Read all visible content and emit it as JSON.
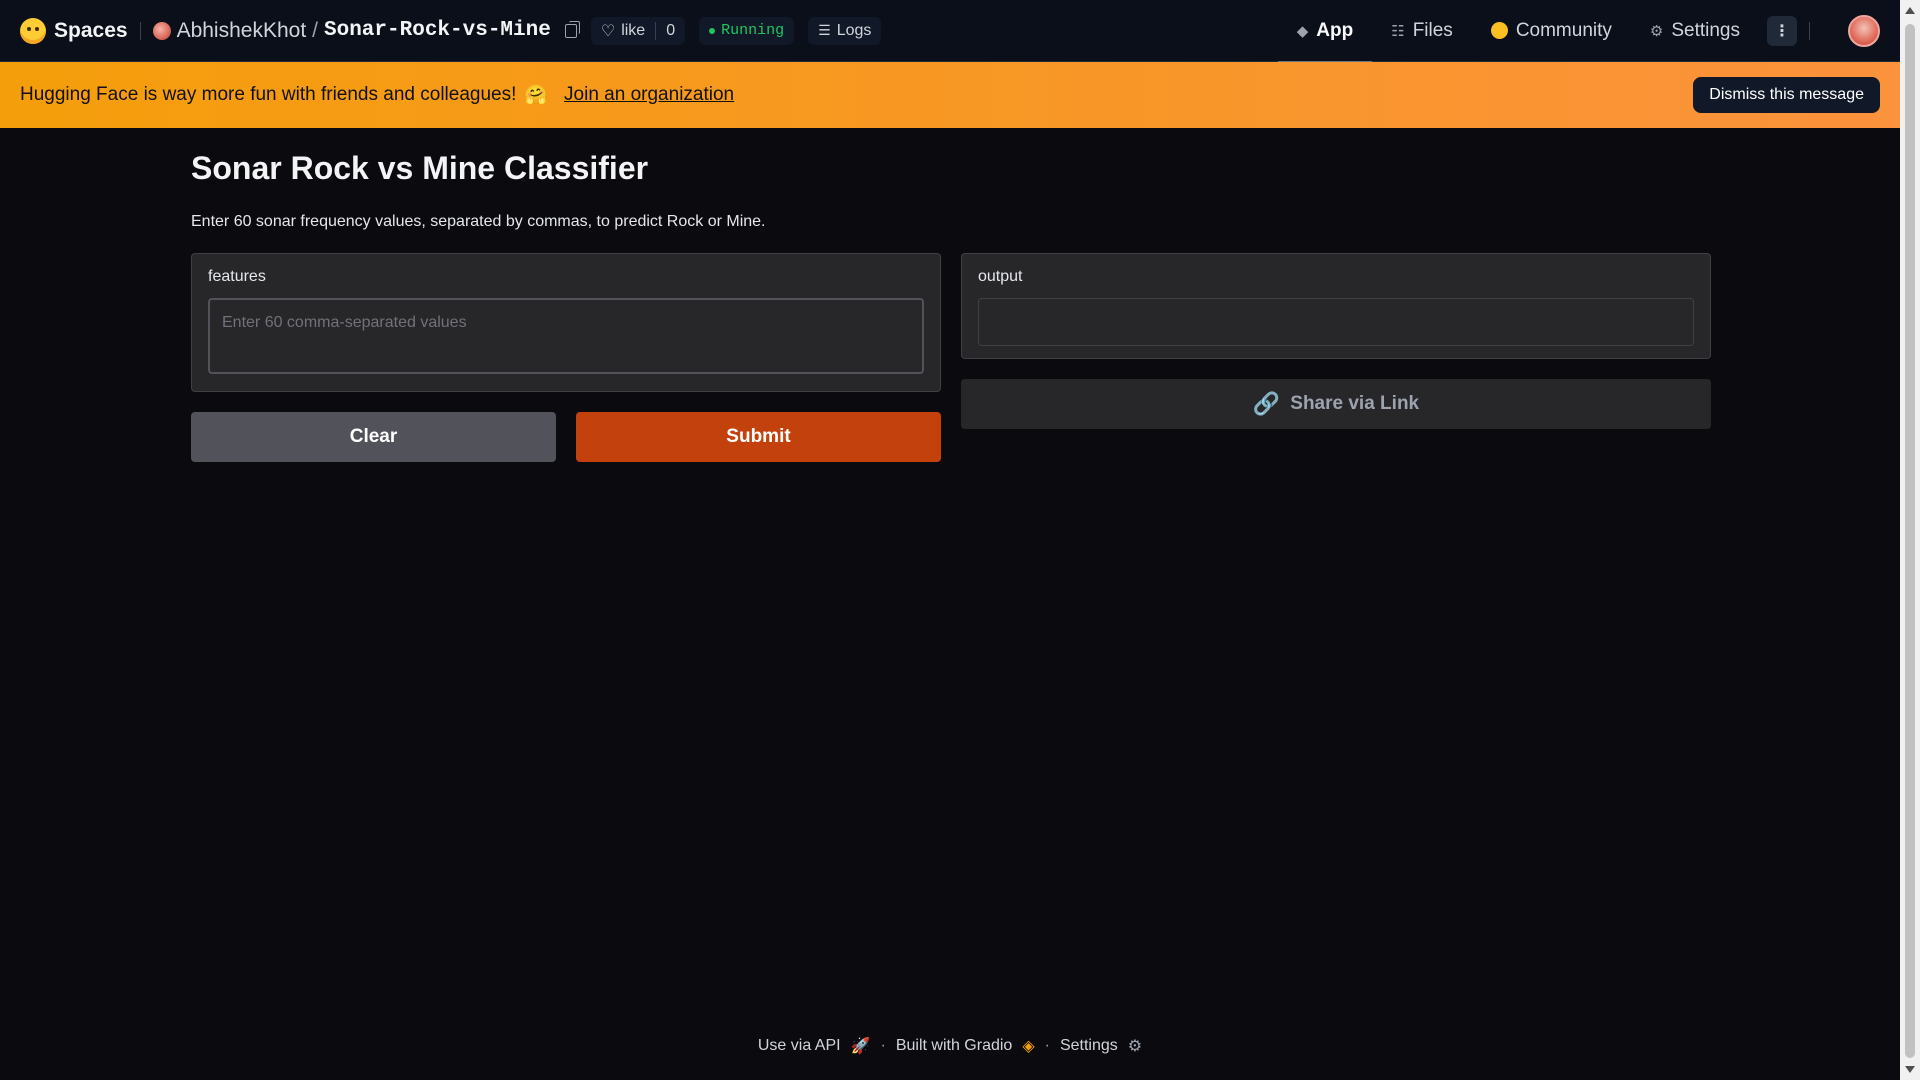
{
  "header": {
    "brand": "Spaces",
    "owner": "AbhishekKhot",
    "separator": "/",
    "repo": "Sonar-Rock-vs-Mine",
    "like_label": "like",
    "like_count": "0",
    "status": "Running",
    "logs_label": "Logs",
    "nav": {
      "app": "App",
      "files": "Files",
      "community": "Community",
      "settings": "Settings"
    },
    "kebab": "⋮"
  },
  "banner": {
    "message": "Hugging Face is way more fun with friends and colleagues!",
    "emoji": "🤗",
    "link": "Join an organization",
    "dismiss": "Dismiss this message"
  },
  "main": {
    "title": "Sonar Rock vs Mine Classifier",
    "description": "Enter 60 sonar frequency values, separated by commas, to predict Rock or Mine.",
    "input_label": "features",
    "input_placeholder": "Enter 60 comma-separated values",
    "input_value": "",
    "output_label": "output",
    "output_value": "",
    "clear": "Clear",
    "submit": "Submit",
    "share": "Share via Link"
  },
  "footer": {
    "api": "Use via API",
    "built": "Built with Gradio",
    "settings": "Settings",
    "dot": "·"
  },
  "colors": {
    "banner": "#f59e0b",
    "submit": "#c2410c",
    "running": "#22c55e"
  }
}
